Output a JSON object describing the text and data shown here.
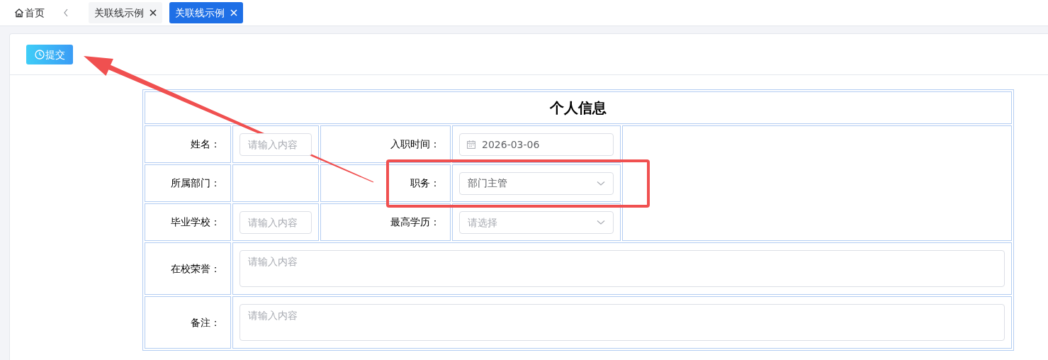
{
  "tabbar": {
    "home": "首页",
    "tabs": [
      {
        "label": "关联线示例",
        "selected": false
      },
      {
        "label": "关联线示例",
        "selected": true
      }
    ]
  },
  "toolbar": {
    "buttons": [
      {
        "label": "提交"
      }
    ]
  },
  "form": {
    "title": "个人信息",
    "rows": [
      {
        "label": "姓名：",
        "field": {
          "kind": "input",
          "placeholder": "请输入内容"
        },
        "label2": "入职时间：",
        "field2": {
          "kind": "date",
          "value": "2026-03-06"
        }
      },
      {
        "label": "所属部门：",
        "label2": "职务：",
        "field2": {
          "kind": "select",
          "value": "部门主管"
        }
      },
      {
        "label": "毕业学校：",
        "field": {
          "kind": "input",
          "placeholder": "请输入内容"
        },
        "label2": "最高学历：",
        "field2": {
          "kind": "select",
          "placeholder": "请选择"
        }
      },
      {
        "label": "在校荣誉：",
        "field": {
          "kind": "textarea",
          "placeholder": "请输入内容"
        }
      },
      {
        "label": "备注：",
        "field": {
          "kind": "textarea",
          "placeholder": "请输入内容"
        }
      }
    ]
  },
  "annotations": [
    {
      "kind": "arrow"
    },
    {
      "kind": "frame"
    }
  ]
}
